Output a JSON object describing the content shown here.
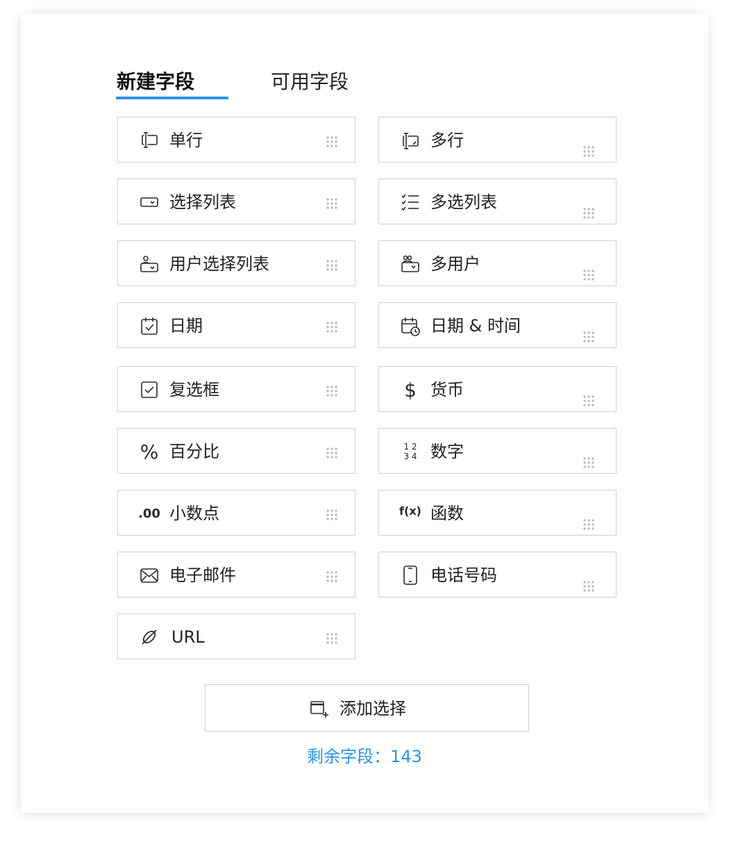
{
  "tabs": {
    "new_fields": "新建字段",
    "available_fields": "可用字段"
  },
  "fields_left": [
    {
      "label": "单行",
      "icon": "single-line-icon"
    },
    {
      "label": "选择列表",
      "icon": "picklist-icon"
    },
    {
      "label": "用户选择列表",
      "icon": "user-picklist-icon"
    },
    {
      "label": "日期",
      "icon": "date-icon"
    },
    {
      "label": "复选框",
      "icon": "checkbox-icon"
    },
    {
      "label": "百分比",
      "icon": "percent-icon"
    },
    {
      "label": "小数点",
      "icon": "decimal-icon"
    },
    {
      "label": "电子邮件",
      "icon": "email-icon"
    },
    {
      "label": "URL",
      "icon": "link-icon"
    }
  ],
  "fields_right": [
    {
      "label": "多行",
      "icon": "multi-line-icon"
    },
    {
      "label": "多选列表",
      "icon": "multi-select-list-icon"
    },
    {
      "label": "多用户",
      "icon": "multi-user-icon"
    },
    {
      "label": "日期 & 时间",
      "icon": "date-time-icon"
    },
    {
      "label": "货币",
      "icon": "currency-icon"
    },
    {
      "label": "数字",
      "icon": "number-icon"
    },
    {
      "label": "函数",
      "icon": "function-icon"
    },
    {
      "label": "电话号码",
      "icon": "phone-icon"
    }
  ],
  "icon_text": {
    "decimal": ".00",
    "function": "f(x)",
    "number_top": "1 2",
    "number_bottom": "3 4",
    "currency": "$",
    "percent": "%"
  },
  "add_button": {
    "label": "添加选择",
    "icon": "add-window-icon"
  },
  "remaining": "剩余字段：143",
  "colors": {
    "accent": "#2b93e6",
    "border": "#cfcfcf",
    "grip": "#b5b5b5"
  }
}
